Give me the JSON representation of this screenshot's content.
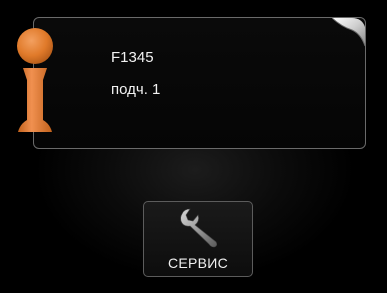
{
  "info_panel": {
    "model": "F1345",
    "unit": "подч. 1",
    "icon": "info-icon"
  },
  "service": {
    "label": "СЕРВИС",
    "icon": "wrench-icon"
  },
  "colors": {
    "icon_orange": "#e07a2a",
    "panel_border": "#6a6a6a",
    "background": "#000000"
  }
}
